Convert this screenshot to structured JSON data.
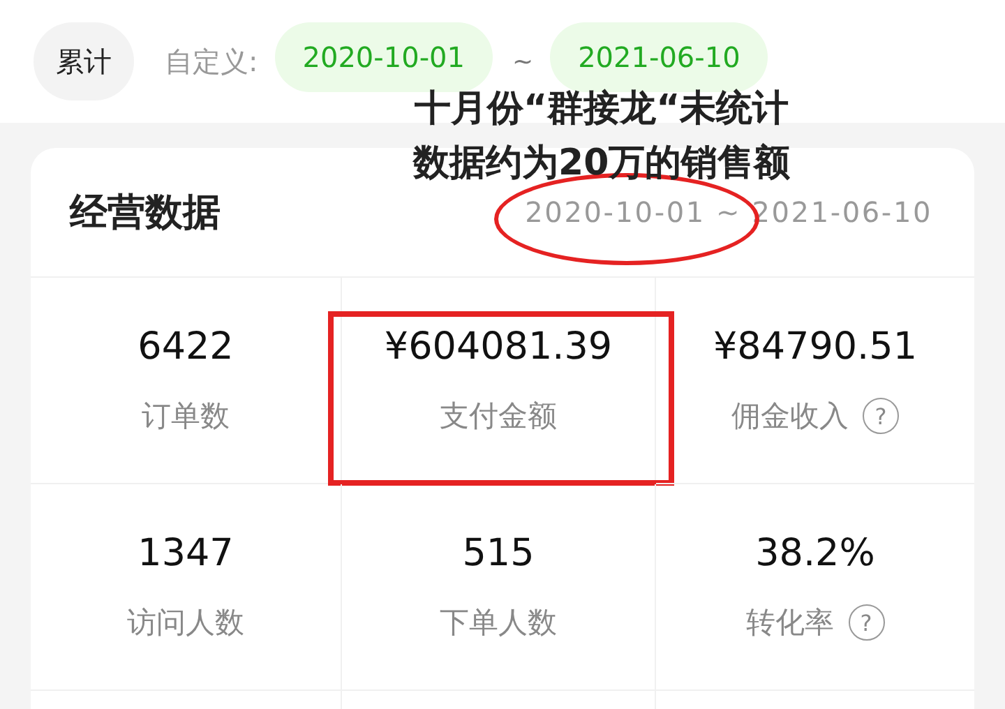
{
  "filter_bar": {
    "tabs": [
      {
        "label": "累计",
        "selected": true
      }
    ],
    "custom_label": "自定义:",
    "date_start": "2020-10-01",
    "separator": "~",
    "date_end": "2021-06-10"
  },
  "annotation_note": [
    "十月份“群接龙“未统计",
    "数据约为20万的销售额"
  ],
  "card": {
    "title": "经营数据",
    "date_range": "2020-10-01 ~ 2021-06-10",
    "date_range_circled": true,
    "metrics": [
      {
        "value": "6422",
        "label": "订单数",
        "help": false,
        "highlighted": false
      },
      {
        "value": "¥604081.39",
        "label": "支付金额",
        "help": false,
        "highlighted": true
      },
      {
        "value": "¥84790.51",
        "label": "佣金收入",
        "help": true,
        "highlighted": false
      },
      {
        "value": "1347",
        "label": "访问人数",
        "help": false,
        "highlighted": false
      },
      {
        "value": "515",
        "label": "下单人数",
        "help": false,
        "highlighted": false
      },
      {
        "value": "38.2%",
        "label": "转化率",
        "help": true,
        "highlighted": false
      }
    ],
    "help_glyph": "?"
  }
}
